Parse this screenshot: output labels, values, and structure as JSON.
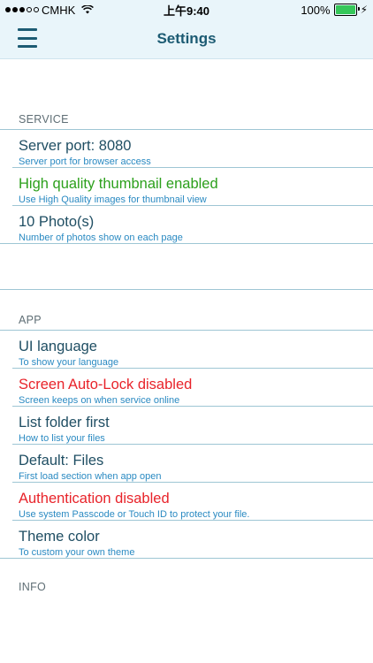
{
  "status_bar": {
    "carrier": "CMHK",
    "time": "上午9:40",
    "battery": "100%"
  },
  "navbar": {
    "title": "Settings"
  },
  "sections": {
    "service": {
      "header": "SERVICE",
      "items": [
        {
          "title": "Server port: 8080",
          "subtitle": "Server port for browser access"
        },
        {
          "title": "High quality thumbnail enabled",
          "subtitle": "Use High Quality images for thumbnail view"
        },
        {
          "title": "10 Photo(s)",
          "subtitle": "Number of photos show on each page"
        }
      ]
    },
    "app": {
      "header": "APP",
      "items": [
        {
          "title": "UI language",
          "subtitle": "To show your language"
        },
        {
          "title": "Screen Auto-Lock disabled",
          "subtitle": "Screen keeps on when service online"
        },
        {
          "title": "List folder first",
          "subtitle": "How to list your files"
        },
        {
          "title": "Default: Files",
          "subtitle": "First load section when app open"
        },
        {
          "title": "Authentication disabled",
          "subtitle": "Use system Passcode or Touch ID to protect your file."
        },
        {
          "title": "Theme color",
          "subtitle": "To custom your own theme"
        }
      ]
    },
    "info": {
      "header": "INFO"
    }
  },
  "colors": {
    "accent": "#1c5b73",
    "subtitle": "#2a8ac2",
    "enabled": "#2ca01c",
    "disabled": "#e8232a"
  }
}
